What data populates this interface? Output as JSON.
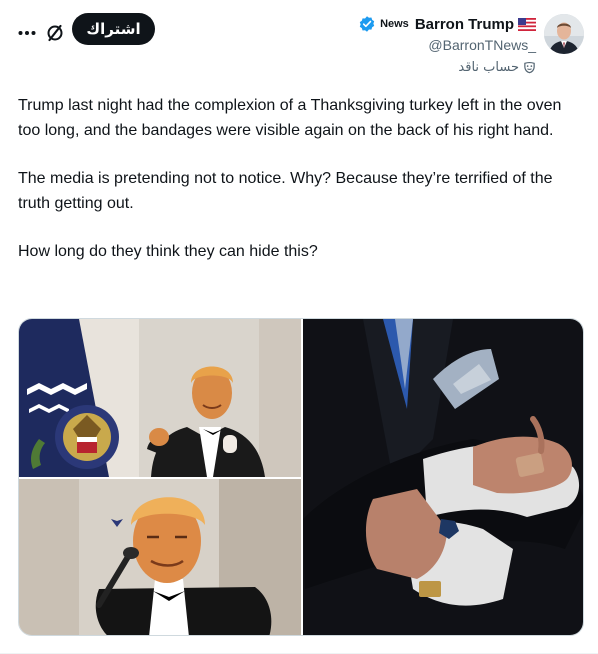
{
  "header": {
    "subscribe_label": "اشتراك",
    "more_icon": "more-horizontal-icon",
    "grok_icon": "grok-icon",
    "news_label": "News",
    "display_name": "Barron Trump",
    "flag_icon": "us-flag-icon",
    "verified_icon": "verified-badge-icon",
    "handle": "@BarronTNews_",
    "parody_label": "حساب ناقد",
    "parody_icon": "parody-mask-icon",
    "verified_color": "#1d9bf0"
  },
  "tweet": {
    "paragraphs": [
      "Trump last night had the complexion of a Thanksgiving turkey left in the oven too long, and the bandages were visible again on the back of his right hand.",
      "The media is pretending not to notice. Why? Because they’re terrified of the truth getting out.",
      "How long do they think they can hide this?"
    ]
  },
  "media": {
    "count": 3,
    "photos": [
      {
        "alt": "photo-1"
      },
      {
        "alt": "photo-2"
      },
      {
        "alt": "photo-3"
      }
    ]
  }
}
